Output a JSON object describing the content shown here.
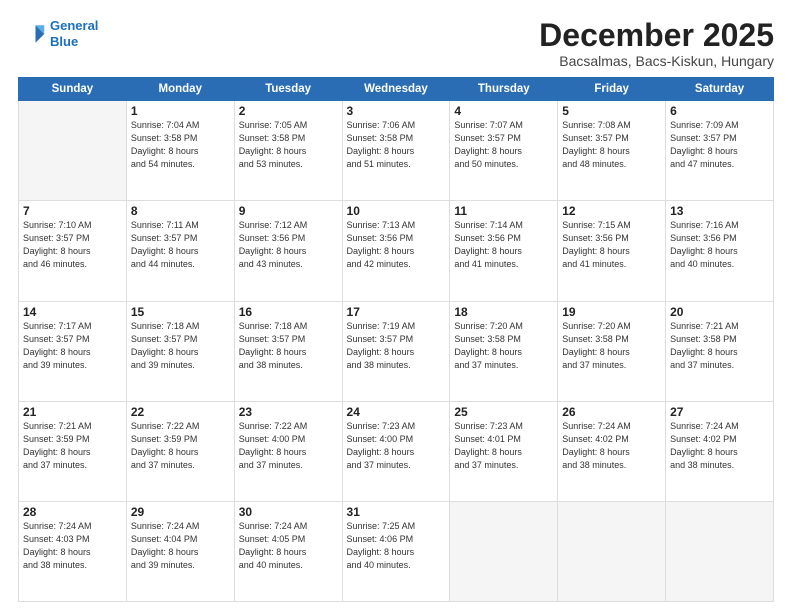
{
  "logo": {
    "line1": "General",
    "line2": "Blue"
  },
  "header": {
    "month": "December 2025",
    "location": "Bacsalmas, Bacs-Kiskun, Hungary"
  },
  "weekdays": [
    "Sunday",
    "Monday",
    "Tuesday",
    "Wednesday",
    "Thursday",
    "Friday",
    "Saturday"
  ],
  "weeks": [
    [
      {
        "day": "",
        "text": ""
      },
      {
        "day": "1",
        "text": "Sunrise: 7:04 AM\nSunset: 3:58 PM\nDaylight: 8 hours\nand 54 minutes."
      },
      {
        "day": "2",
        "text": "Sunrise: 7:05 AM\nSunset: 3:58 PM\nDaylight: 8 hours\nand 53 minutes."
      },
      {
        "day": "3",
        "text": "Sunrise: 7:06 AM\nSunset: 3:58 PM\nDaylight: 8 hours\nand 51 minutes."
      },
      {
        "day": "4",
        "text": "Sunrise: 7:07 AM\nSunset: 3:57 PM\nDaylight: 8 hours\nand 50 minutes."
      },
      {
        "day": "5",
        "text": "Sunrise: 7:08 AM\nSunset: 3:57 PM\nDaylight: 8 hours\nand 48 minutes."
      },
      {
        "day": "6",
        "text": "Sunrise: 7:09 AM\nSunset: 3:57 PM\nDaylight: 8 hours\nand 47 minutes."
      }
    ],
    [
      {
        "day": "7",
        "text": "Sunrise: 7:10 AM\nSunset: 3:57 PM\nDaylight: 8 hours\nand 46 minutes."
      },
      {
        "day": "8",
        "text": "Sunrise: 7:11 AM\nSunset: 3:57 PM\nDaylight: 8 hours\nand 44 minutes."
      },
      {
        "day": "9",
        "text": "Sunrise: 7:12 AM\nSunset: 3:56 PM\nDaylight: 8 hours\nand 43 minutes."
      },
      {
        "day": "10",
        "text": "Sunrise: 7:13 AM\nSunset: 3:56 PM\nDaylight: 8 hours\nand 42 minutes."
      },
      {
        "day": "11",
        "text": "Sunrise: 7:14 AM\nSunset: 3:56 PM\nDaylight: 8 hours\nand 41 minutes."
      },
      {
        "day": "12",
        "text": "Sunrise: 7:15 AM\nSunset: 3:56 PM\nDaylight: 8 hours\nand 41 minutes."
      },
      {
        "day": "13",
        "text": "Sunrise: 7:16 AM\nSunset: 3:56 PM\nDaylight: 8 hours\nand 40 minutes."
      }
    ],
    [
      {
        "day": "14",
        "text": "Sunrise: 7:17 AM\nSunset: 3:57 PM\nDaylight: 8 hours\nand 39 minutes."
      },
      {
        "day": "15",
        "text": "Sunrise: 7:18 AM\nSunset: 3:57 PM\nDaylight: 8 hours\nand 39 minutes."
      },
      {
        "day": "16",
        "text": "Sunrise: 7:18 AM\nSunset: 3:57 PM\nDaylight: 8 hours\nand 38 minutes."
      },
      {
        "day": "17",
        "text": "Sunrise: 7:19 AM\nSunset: 3:57 PM\nDaylight: 8 hours\nand 38 minutes."
      },
      {
        "day": "18",
        "text": "Sunrise: 7:20 AM\nSunset: 3:58 PM\nDaylight: 8 hours\nand 37 minutes."
      },
      {
        "day": "19",
        "text": "Sunrise: 7:20 AM\nSunset: 3:58 PM\nDaylight: 8 hours\nand 37 minutes."
      },
      {
        "day": "20",
        "text": "Sunrise: 7:21 AM\nSunset: 3:58 PM\nDaylight: 8 hours\nand 37 minutes."
      }
    ],
    [
      {
        "day": "21",
        "text": "Sunrise: 7:21 AM\nSunset: 3:59 PM\nDaylight: 8 hours\nand 37 minutes."
      },
      {
        "day": "22",
        "text": "Sunrise: 7:22 AM\nSunset: 3:59 PM\nDaylight: 8 hours\nand 37 minutes."
      },
      {
        "day": "23",
        "text": "Sunrise: 7:22 AM\nSunset: 4:00 PM\nDaylight: 8 hours\nand 37 minutes."
      },
      {
        "day": "24",
        "text": "Sunrise: 7:23 AM\nSunset: 4:00 PM\nDaylight: 8 hours\nand 37 minutes."
      },
      {
        "day": "25",
        "text": "Sunrise: 7:23 AM\nSunset: 4:01 PM\nDaylight: 8 hours\nand 37 minutes."
      },
      {
        "day": "26",
        "text": "Sunrise: 7:24 AM\nSunset: 4:02 PM\nDaylight: 8 hours\nand 38 minutes."
      },
      {
        "day": "27",
        "text": "Sunrise: 7:24 AM\nSunset: 4:02 PM\nDaylight: 8 hours\nand 38 minutes."
      }
    ],
    [
      {
        "day": "28",
        "text": "Sunrise: 7:24 AM\nSunset: 4:03 PM\nDaylight: 8 hours\nand 38 minutes."
      },
      {
        "day": "29",
        "text": "Sunrise: 7:24 AM\nSunset: 4:04 PM\nDaylight: 8 hours\nand 39 minutes."
      },
      {
        "day": "30",
        "text": "Sunrise: 7:24 AM\nSunset: 4:05 PM\nDaylight: 8 hours\nand 40 minutes."
      },
      {
        "day": "31",
        "text": "Sunrise: 7:25 AM\nSunset: 4:06 PM\nDaylight: 8 hours\nand 40 minutes."
      },
      {
        "day": "",
        "text": ""
      },
      {
        "day": "",
        "text": ""
      },
      {
        "day": "",
        "text": ""
      }
    ]
  ]
}
